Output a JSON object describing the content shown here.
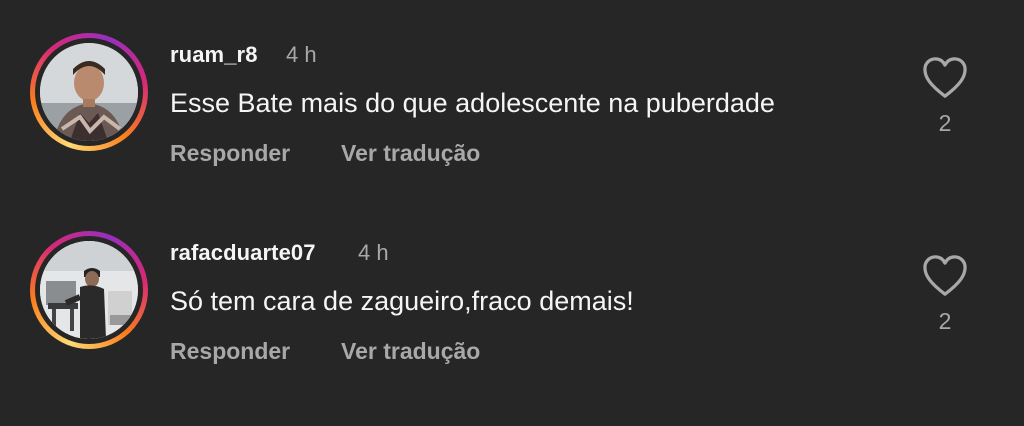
{
  "comments": [
    {
      "username": "ruam_r8",
      "time": "4 h",
      "text": "Esse Bate mais do que adolescente na puberdade",
      "reply_label": "Responder",
      "translate_label": "Ver tradução",
      "like_count": "2",
      "like_icon": "heart-outline-icon"
    },
    {
      "username": "rafacduarte07",
      "time": "4 h",
      "text": "Só tem cara de zagueiro,fraco demais!",
      "reply_label": "Responder",
      "translate_label": "Ver tradução",
      "like_count": "2",
      "like_icon": "heart-outline-icon"
    }
  ],
  "colors": {
    "background": "#262626",
    "primary_text": "#f5f5f5",
    "secondary_text": "#a8a8a8",
    "story_ring": [
      "#feda75",
      "#fa7e1e",
      "#d62976",
      "#962fbf"
    ]
  }
}
